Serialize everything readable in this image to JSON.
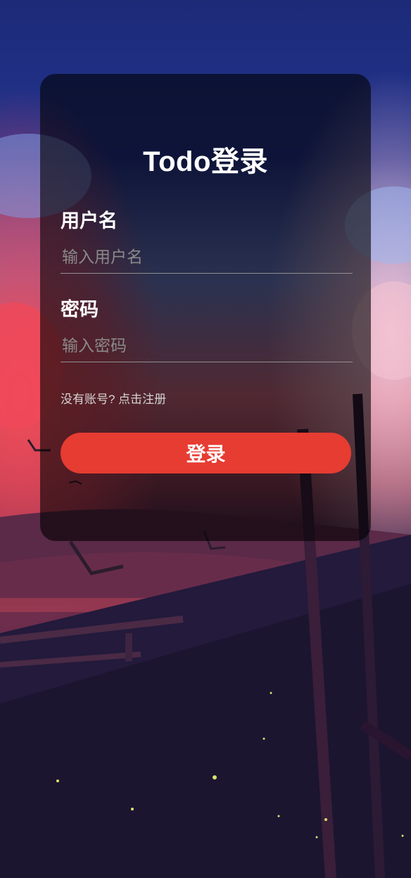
{
  "login": {
    "title": "Todo登录",
    "username_label": "用户名",
    "username_placeholder": "输入用户名",
    "username_value": "",
    "password_label": "密码",
    "password_placeholder": "输入密码",
    "password_value": "",
    "register_link": "没有账号? 点击注册",
    "submit_label": "登录"
  },
  "colors": {
    "accent": "#e63c32",
    "card_overlay": "rgba(0,0,0,0.60)",
    "text": "#ffffff",
    "placeholder": "#8a8a8a",
    "divider": "#8f8f8f"
  }
}
